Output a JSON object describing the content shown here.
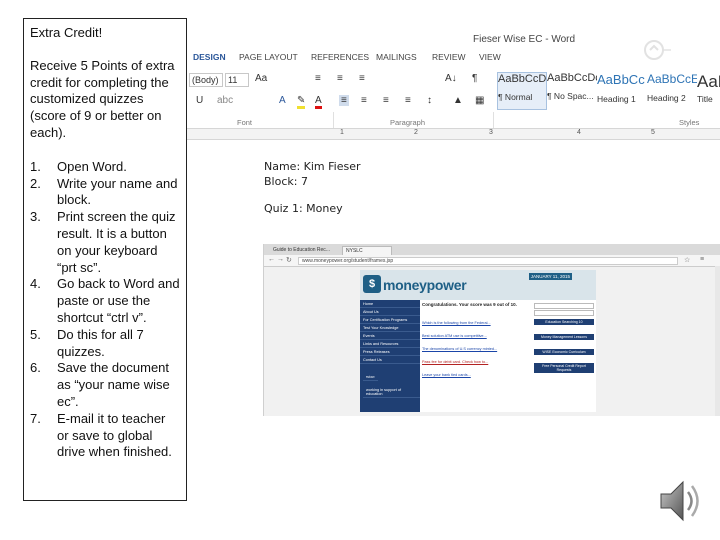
{
  "instructions": {
    "title": "Extra Credit!",
    "intro": "Receive 5 Points of extra credit for completing the customized quizzes (score of 9 or better on each).",
    "steps": [
      {
        "num": "1.",
        "text": "Open Word."
      },
      {
        "num": "2.",
        "text": "Write your name and block."
      },
      {
        "num": "3.",
        "text": "Print screen the quiz result. It is a button on your keyboard “prt sc”."
      },
      {
        "num": "4.",
        "text": "Go back to Word and paste or use the shortcut “ctrl v”."
      },
      {
        "num": "5.",
        "text": "Do this for all 7 quizzes."
      },
      {
        "num": "6.",
        "text": "Save the document as “your name wise ec”."
      },
      {
        "num": "7.",
        "text": "E-mail it to teacher or save to global drive when finished."
      }
    ]
  },
  "word": {
    "window_title": "Fieser Wise EC - Word",
    "tabs": [
      "DESIGN",
      "PAGE LAYOUT",
      "REFERENCES",
      "MAILINGS",
      "REVIEW",
      "VIEW"
    ],
    "font_name": "(Body)",
    "font_size": "11",
    "aa_label": "Aa",
    "groups": {
      "font": "Font",
      "paragraph": "Paragraph",
      "styles": "Styles"
    },
    "styles": [
      {
        "sample": "AaBbCcDc",
        "name": "¶ Normal",
        "selected": true
      },
      {
        "sample": "AaBbCcDc",
        "name": "¶ No Spac...",
        "selected": false
      },
      {
        "sample": "AaBbCc",
        "name": "Heading 1",
        "selected": false
      },
      {
        "sample": "AaBbCcE",
        "name": "Heading 2",
        "selected": false
      },
      {
        "sample": "AaB",
        "name": "Title",
        "selected": false
      }
    ],
    "ruler_numbers": [
      "1",
      "2",
      "3",
      "4",
      "5"
    ],
    "doc_lines": {
      "name": "Name: Kim Fieser",
      "block": "Block: 7",
      "quiz": "Quiz 1: Money"
    }
  },
  "browser": {
    "tabs": [
      "Guide to Education Rec...",
      "NYSLC"
    ],
    "url": "www.moneypower.org/student/frames.jsp",
    "site": {
      "logo": "moneypower",
      "date": "JANUARY 11, 2015",
      "nav": [
        "Home",
        "About Us",
        "For Certification Programs",
        "Test Your Knowledge",
        "Events",
        "Links and Resources",
        "Press Releases",
        "Contact Us"
      ],
      "brand": "wise",
      "brand_sub": "working in support of education",
      "congrats": "Congratulations. Your score was 9 out of 10.",
      "links": [
        {
          "text": "Which is the following from the Federal...",
          "red": false
        },
        {
          "text": "Best solution ATM use is competitive...",
          "red": false
        },
        {
          "text": "The denominations of U.S currency minted...",
          "red": false
        },
        {
          "text": "Pass fee for debit card. Check how to...",
          "red": true
        },
        {
          "text": "Leave your bank tied cards...",
          "red": false
        }
      ],
      "right_headers": [
        "Education Searching 10",
        "Money Management Lessons",
        "WISE Economic Curriculum",
        "Free Personal Credit Report Requests"
      ]
    }
  }
}
